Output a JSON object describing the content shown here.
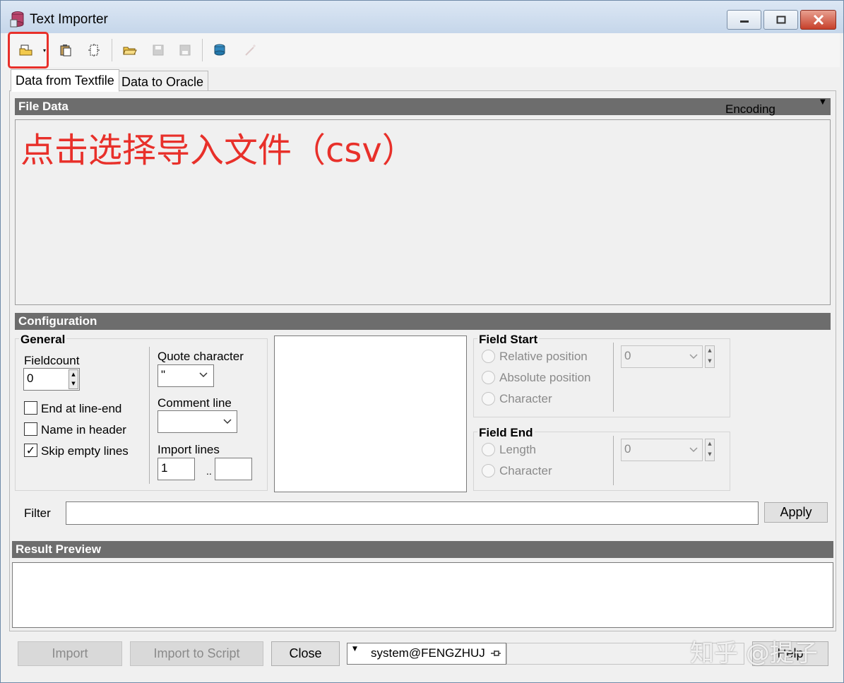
{
  "window": {
    "title": "Text Importer"
  },
  "tabs": [
    "Data from Textfile",
    "Data to Oracle"
  ],
  "file_data": {
    "header": "File Data",
    "encoding_label": "Encoding",
    "annotation": "点击选择导入文件（csv）"
  },
  "configuration": {
    "header": "Configuration",
    "general": {
      "title": "General",
      "fieldcount_label": "Fieldcount",
      "fieldcount_value": "0",
      "end_at_line_end": "End at line-end",
      "name_in_header": "Name in header",
      "skip_empty_lines": "Skip empty lines",
      "skip_empty_lines_checked": "✓",
      "quote_char_label": "Quote character",
      "quote_char_value": "\"",
      "comment_line_label": "Comment line",
      "comment_line_value": "",
      "import_lines_label": "Import lines",
      "import_lines_from": "1",
      "import_lines_sep": "..",
      "import_lines_to": ""
    },
    "field_start": {
      "title": "Field Start",
      "options": [
        "Relative position",
        "Absolute position",
        "Character"
      ],
      "value": "0"
    },
    "field_end": {
      "title": "Field End",
      "options": [
        "Length",
        "Character"
      ],
      "value": "0"
    }
  },
  "filter": {
    "label": "Filter",
    "value": "",
    "apply_label": "Apply"
  },
  "result_preview": {
    "header": "Result Preview"
  },
  "footer": {
    "import_label": "Import",
    "import_script_label": "Import to Script",
    "close_label": "Close",
    "connection": "system@FENGZHUJ",
    "help_label": "Help"
  },
  "watermark": "知乎 @提子"
}
